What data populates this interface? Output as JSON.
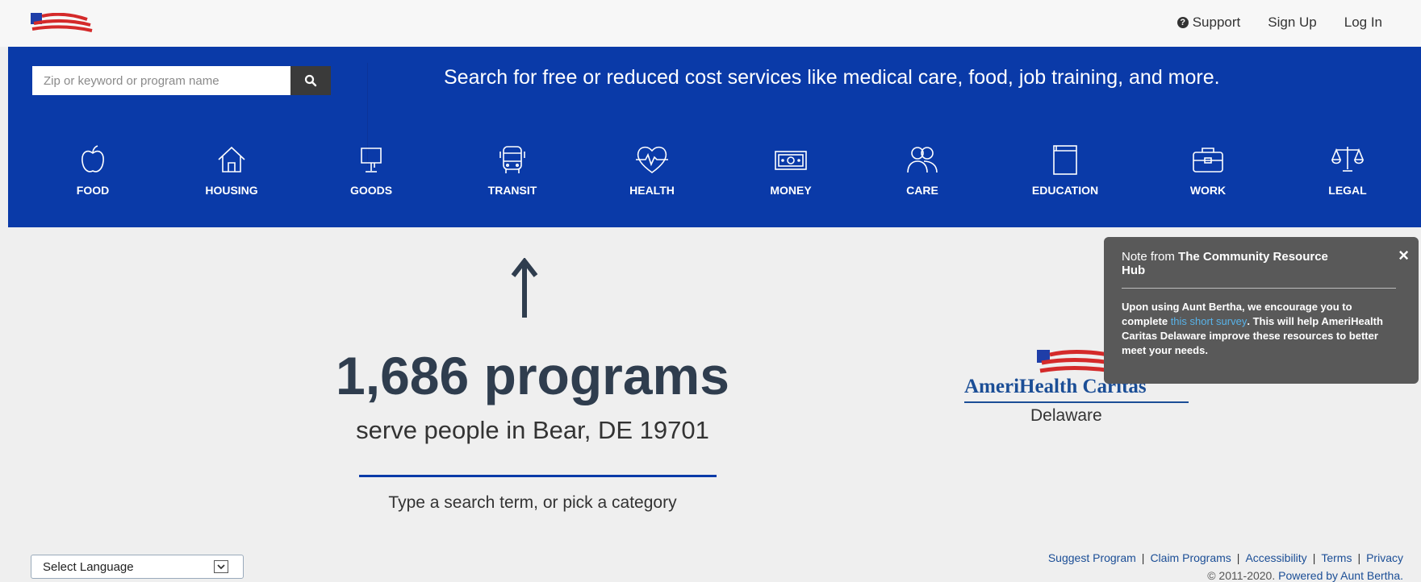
{
  "header": {
    "support_label": "Support",
    "signup_label": "Sign Up",
    "login_label": "Log In"
  },
  "search": {
    "placeholder": "Zip or keyword or program name",
    "tagline": "Search for free or reduced cost services like medical care, food, job training, and more."
  },
  "categories": [
    {
      "label": "FOOD",
      "icon": "apple-icon"
    },
    {
      "label": "HOUSING",
      "icon": "house-icon"
    },
    {
      "label": "GOODS",
      "icon": "lamp-icon"
    },
    {
      "label": "TRANSIT",
      "icon": "bus-icon"
    },
    {
      "label": "HEALTH",
      "icon": "heart-pulse-icon"
    },
    {
      "label": "MONEY",
      "icon": "money-icon"
    },
    {
      "label": "CARE",
      "icon": "people-icon"
    },
    {
      "label": "EDUCATION",
      "icon": "book-icon"
    },
    {
      "label": "WORK",
      "icon": "briefcase-icon"
    },
    {
      "label": "LEGAL",
      "icon": "scales-icon"
    }
  ],
  "main": {
    "count_text": "1,686 programs",
    "serve_text": "serve people in Bear, DE 19701",
    "hint_text": "Type a search term, or pick a category"
  },
  "partner": {
    "name": "AmeriHealth Caritas",
    "state": "Delaware"
  },
  "note": {
    "prefix": "Note from ",
    "org": "The Community Resource Hub",
    "body_before": "Upon using Aunt Bertha, we encourage you to complete ",
    "link": "this short survey",
    "body_after": ". This will help AmeriHealth Caritas Delaware improve these resources to better meet your needs.",
    "close": "×"
  },
  "footer": {
    "language_label": "Select Language",
    "links": [
      "Suggest Program",
      "Claim Programs",
      "Accessibility",
      "Terms",
      "Privacy"
    ],
    "copyright": "© 2011-2020. ",
    "powered_by": "Powered by Aunt Bertha."
  },
  "colors": {
    "brand_blue": "#0a3aa8",
    "dark_text": "#2f3d4e",
    "note_bg": "#595959"
  }
}
